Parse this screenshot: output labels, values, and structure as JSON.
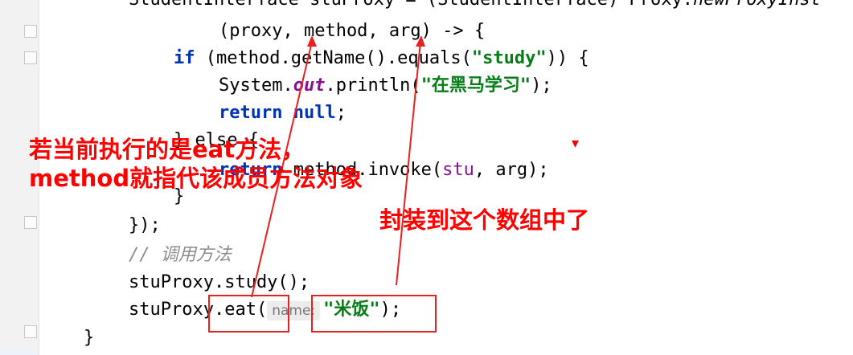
{
  "code": {
    "line0": "StudentInterface stuProxy = (StudentInterface) Proxy.",
    "line0_method": "newProxyInst",
    "line1": "(proxy, method, arg) -> {",
    "line2_kw": "if",
    "line2_a": " (method.getName().equals(",
    "line2_str": "\"study\"",
    "line2_b": ")) {",
    "line3_a": "System.",
    "line3_field": "out",
    "line3_b": ".println(",
    "line3_str": "\"在黑马学习\"",
    "line3_c": ");",
    "line4_kw1": "return",
    "line4_kw2": "null",
    "line4_end": ";",
    "line5": "} else {",
    "line6_kw": "return",
    "line6_a": " method.invoke(",
    "line6_var": "stu",
    "line6_b": ", arg);",
    "line7": "}",
    "line8": "});",
    "line9_comment": "// 调用方法",
    "line10": "stuProxy.study();",
    "line11_a": "stuProxy.eat(",
    "line11_hint": "name:",
    "line11_str": "\"米饭\"",
    "line11_b": ");",
    "line12": "}"
  },
  "annotations": {
    "note1_line1": "若当前执行的是eat方法，",
    "note1_line2": "method就指代该成员方法对象",
    "note2": "封装到这个数组中了",
    "caret": "▾"
  },
  "colors": {
    "annotation": "#ff0000",
    "keyword": "#0033b3",
    "string": "#067d17",
    "field": "#871094",
    "comment": "#8c8c8c"
  }
}
